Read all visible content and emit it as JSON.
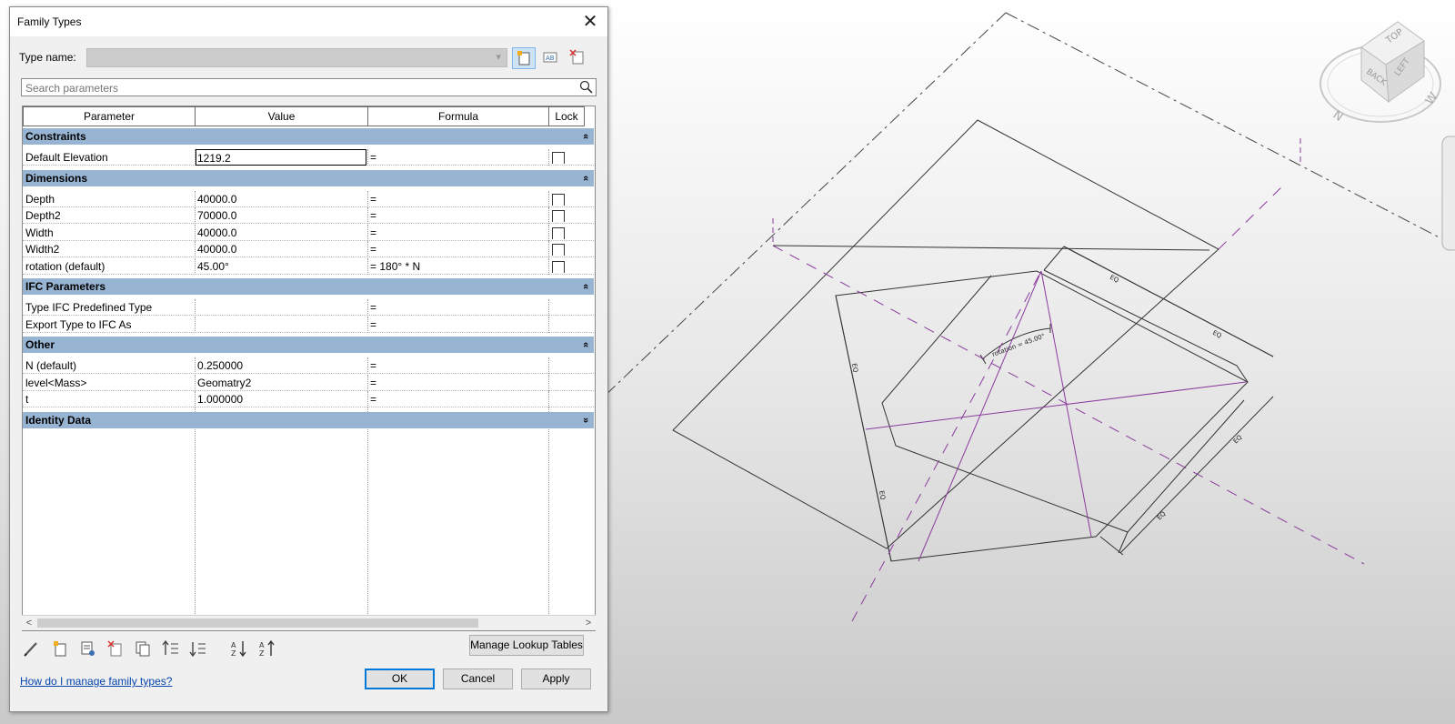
{
  "dialog": {
    "title": "Family Types",
    "type_name_label": "Type name:",
    "type_name_value": "",
    "search_placeholder": "Search parameters",
    "columns": [
      "Parameter",
      "Value",
      "Formula",
      "Lock"
    ],
    "groups": [
      {
        "name": "Constraints",
        "toggle": "collapse",
        "rows": [
          {
            "param": "Default Elevation",
            "value": "1219.2",
            "formula": "=",
            "lock": false,
            "has_lock": true,
            "editing": true
          }
        ]
      },
      {
        "name": "Dimensions",
        "toggle": "collapse",
        "rows": [
          {
            "param": "Depth",
            "value": "40000.0",
            "formula": "=",
            "lock": false,
            "has_lock": true
          },
          {
            "param": "Depth2",
            "value": "70000.0",
            "formula": "=",
            "lock": false,
            "has_lock": true
          },
          {
            "param": "Width",
            "value": "40000.0",
            "formula": "=",
            "lock": false,
            "has_lock": true
          },
          {
            "param": "Width2",
            "value": "40000.0",
            "formula": "=",
            "lock": false,
            "has_lock": true
          },
          {
            "param": "rotation (default)",
            "value": "45.00°",
            "formula": "= 180° * N",
            "lock": false,
            "has_lock": true
          }
        ]
      },
      {
        "name": "IFC Parameters",
        "toggle": "collapse",
        "rows": [
          {
            "param": "Type IFC Predefined Type",
            "value": "",
            "formula": "=",
            "has_lock": false
          },
          {
            "param": "Export Type to IFC As",
            "value": "",
            "formula": "=",
            "has_lock": false
          }
        ]
      },
      {
        "name": "Other",
        "toggle": "collapse",
        "rows": [
          {
            "param": "N (default)",
            "value": "0.250000",
            "formula": "=",
            "has_lock": false
          },
          {
            "param": "level<Mass>",
            "value": "Geomatry2",
            "formula": "=",
            "has_lock": false
          },
          {
            "param": "t",
            "value": "1.000000",
            "formula": "=",
            "has_lock": false
          }
        ]
      },
      {
        "name": "Identity Data",
        "toggle": "expand",
        "rows": []
      }
    ],
    "toolbar_icons": [
      "edit-type-icon",
      "new-parameter-icon",
      "modify-parameter-icon",
      "delete-parameter-icon",
      "duplicate-icon",
      "move-up-icon",
      "move-down-icon",
      "sort-ascending-icon",
      "sort-descending-icon"
    ],
    "manage_lookup_label": "Manage Lookup Tables",
    "help_link": "How do I manage family types?",
    "ok_label": "OK",
    "cancel_label": "Cancel",
    "apply_label": "Apply"
  },
  "viewcube": {
    "faces": [
      "TOP",
      "BACK",
      "LEFT"
    ],
    "compass": [
      "N",
      "W"
    ]
  },
  "colors": {
    "group_header": "#98b4d3",
    "reference_plane": "#8b3a9e",
    "link": "#0645ad"
  }
}
